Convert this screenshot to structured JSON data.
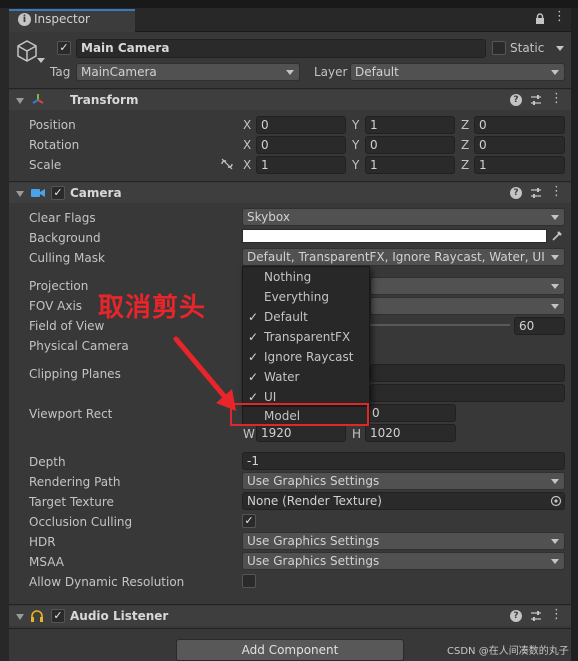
{
  "tab": {
    "label": "Inspector"
  },
  "gameobject": {
    "name": "Main Camera",
    "static_label": "Static",
    "tag_label": "Tag",
    "tag_value": "MainCamera",
    "layer_label": "Layer",
    "layer_value": "Default"
  },
  "transform": {
    "title": "Transform",
    "rows": [
      {
        "label": "Position",
        "x": "0",
        "y": "1",
        "z": "0"
      },
      {
        "label": "Rotation",
        "x": "0",
        "y": "0",
        "z": "0"
      },
      {
        "label": "Scale",
        "x": "1",
        "y": "1",
        "z": "1"
      }
    ]
  },
  "camera": {
    "title": "Camera",
    "clear_flags_label": "Clear Flags",
    "clear_flags_value": "Skybox",
    "background_label": "Background",
    "background_color": "#ffffff",
    "culling_mask_label": "Culling Mask",
    "culling_mask_value": "Default, TransparentFX, Ignore Raycast, Water, UI",
    "projection_label": "Projection",
    "fov_axis_label": "FOV Axis",
    "fov_label": "Field of View",
    "fov_value": "60",
    "physical_label": "Physical Camera",
    "clipping_label": "Clipping Planes",
    "viewport_label": "Viewport Rect",
    "viewport_y_partial": "0",
    "viewport_w_label": "W",
    "viewport_w": "1920",
    "viewport_h_label": "H",
    "viewport_h": "1020",
    "depth_label": "Depth",
    "depth_value": "-1",
    "rendering_path_label": "Rendering Path",
    "rendering_path_value": "Use Graphics Settings",
    "target_texture_label": "Target Texture",
    "target_texture_value": "None (Render Texture)",
    "occlusion_label": "Occlusion Culling",
    "hdr_label": "HDR",
    "hdr_value": "Use Graphics Settings",
    "msaa_label": "MSAA",
    "msaa_value": "Use Graphics Settings",
    "dynres_label": "Allow Dynamic Resolution"
  },
  "culling_popup": {
    "items": [
      {
        "label": "Nothing",
        "checked": false
      },
      {
        "label": "Everything",
        "checked": false
      },
      {
        "label": "Default",
        "checked": true
      },
      {
        "label": "TransparentFX",
        "checked": true
      },
      {
        "label": "Ignore Raycast",
        "checked": true
      },
      {
        "label": "Water",
        "checked": true
      },
      {
        "label": "UI",
        "checked": true
      },
      {
        "label": "Model",
        "checked": false
      }
    ]
  },
  "audio": {
    "title": "Audio Listener"
  },
  "add_component_label": "Add Component",
  "annotation_text": "取消剪头",
  "watermark": "CSDN @在人间凑数的丸子",
  "axis": {
    "x": "X",
    "y": "Y",
    "z": "Z"
  },
  "check_glyph": "✓",
  "colors": {
    "accent": "#3a79bb",
    "annotation": "#e8252a",
    "panel": "#383838"
  }
}
